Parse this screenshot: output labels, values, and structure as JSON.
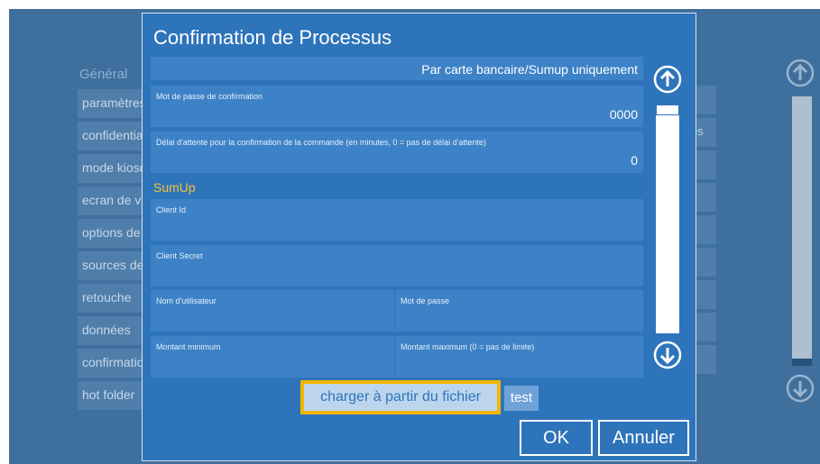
{
  "background": {
    "section_title": "Général",
    "menu_items": [
      "paramètres",
      "confidentialité",
      "mode kiosque",
      "ecran de veille",
      "options de",
      "sources de",
      "retouche",
      "données",
      "confirmation",
      "hot folder"
    ],
    "right_partial_text": "es",
    "scroll_up_icon": "arrow-up-circle-icon",
    "scroll_down_icon": "arrow-down-circle-icon"
  },
  "dialog": {
    "title": "Confirmation de Processus",
    "payment_mode_value": "Par carte bancaire/Sumup uniquement",
    "password_label": "Mot de passe de confirmation",
    "password_value": "0000",
    "timeout_label": "Délai d'attente pour la confirmation de la commande (en minutes, 0 = pas de délai d'attente)",
    "timeout_value": "0",
    "sumup_section": "SumUp",
    "client_id_label": "Client Id",
    "client_secret_label": "Client Secret",
    "username_label": "Nom d'utilisateur",
    "user_password_label": "Mot de passe",
    "min_amount_label": "Montant minimum",
    "max_amount_label": "Montant maximum (0 = pas de limite)",
    "load_button": "charger à partir du fichier",
    "test_button": "test",
    "ok_button": "OK",
    "cancel_button": "Annuler"
  },
  "colors": {
    "dialog_bg": "#2e74bb",
    "field_bg": "#3d82c6",
    "section_accent": "#f2c236",
    "highlight_outline": "#f2b600",
    "backdrop": "#3f6f9d"
  }
}
